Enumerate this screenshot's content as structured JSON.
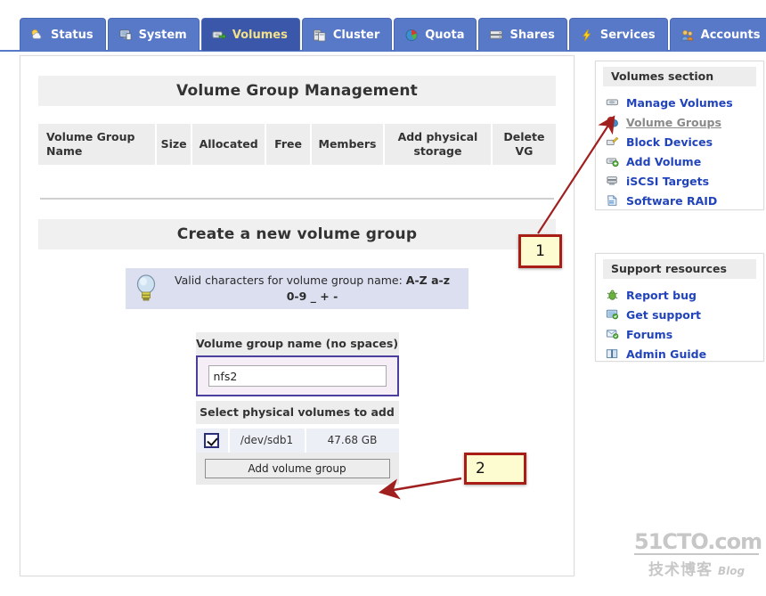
{
  "nav": {
    "tabs": [
      {
        "label": "Status",
        "icon": "weather-sun-cloud-icon",
        "active": false
      },
      {
        "label": "System",
        "icon": "monitor-icon",
        "active": false
      },
      {
        "label": "Volumes",
        "icon": "disk-export-icon",
        "active": true
      },
      {
        "label": "Cluster",
        "icon": "servers-stack-icon",
        "active": false
      },
      {
        "label": "Quota",
        "icon": "pie-chart-icon",
        "active": false
      },
      {
        "label": "Shares",
        "icon": "drive-shares-icon",
        "active": false
      },
      {
        "label": "Services",
        "icon": "lightning-bolt-icon",
        "active": false
      },
      {
        "label": "Accounts",
        "icon": "users-group-icon",
        "active": false
      }
    ]
  },
  "main": {
    "management": {
      "title": "Volume Group Management",
      "columns": [
        "Volume Group Name",
        "Size",
        "Allocated",
        "Free",
        "Members",
        "Add physical storage",
        "Delete VG"
      ],
      "rows": []
    },
    "create": {
      "title": "Create a new volume group",
      "tip_prefix": "Valid characters for volume group name: ",
      "tip_chars": "A-Z a-z 0-9 _ + -",
      "tip_icon": "lightbulb-icon",
      "name_label": "Volume group name (no spaces)",
      "name_value": "nfs2",
      "name_placeholder": "",
      "pv_label": "Select physical volumes to add",
      "physical_volumes": [
        {
          "checked": true,
          "device": "/dev/sdb1",
          "size": "47.68 GB"
        }
      ],
      "submit_label": "Add volume group"
    }
  },
  "sidebar": {
    "volumes_panel": {
      "title": "Volumes section",
      "items": [
        {
          "label": "Manage Volumes",
          "icon": "drive-icon",
          "current": false
        },
        {
          "label": "Volume Groups",
          "icon": "volume-group-icon",
          "current": true
        },
        {
          "label": "Block Devices",
          "icon": "block-device-icon",
          "current": false
        },
        {
          "label": "Add Volume",
          "icon": "add-volume-icon",
          "current": false
        },
        {
          "label": "iSCSI Targets",
          "icon": "iscsi-target-icon",
          "current": false
        },
        {
          "label": "Software RAID",
          "icon": "software-raid-icon",
          "current": false
        }
      ]
    },
    "support_panel": {
      "title": "Support resources",
      "items": [
        {
          "label": "Report bug",
          "icon": "bug-icon"
        },
        {
          "label": "Get support",
          "icon": "support-screen-icon"
        },
        {
          "label": "Forums",
          "icon": "forum-icon"
        },
        {
          "label": "Admin Guide",
          "icon": "book-icon"
        }
      ]
    }
  },
  "annotations": [
    {
      "id": "1",
      "label": "1",
      "points_to": "sidebar-item-volume-groups"
    },
    {
      "id": "2",
      "label": "2",
      "points_to": "add-volume-group-button"
    }
  ],
  "watermark": {
    "top": "51CTO.com",
    "cn": "技术博客",
    "blog": "Blog"
  },
  "colors": {
    "tab_bar": "#5878c8",
    "tab_active": "#3a57aa",
    "tab_active_text": "#f3e08a",
    "link": "#2244bb",
    "callout_fill": "#fdfbd0",
    "callout_border": "#a81e16",
    "arrow": "#a02020",
    "panel_head": "#ededed"
  }
}
